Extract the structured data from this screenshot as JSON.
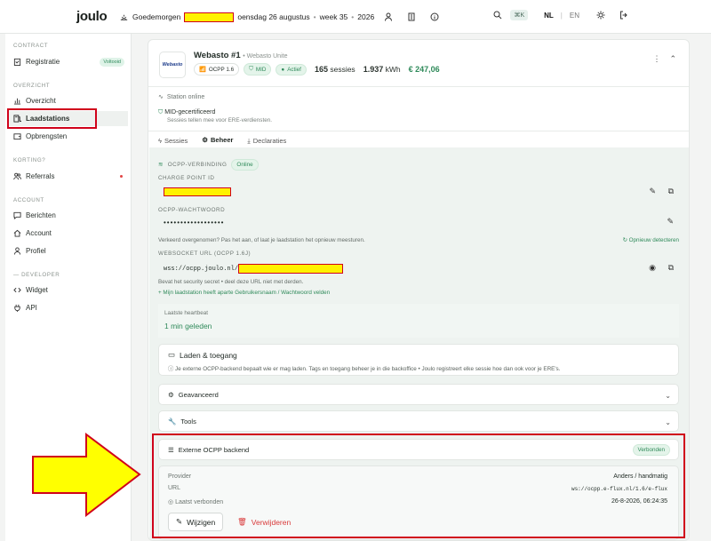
{
  "topbar": {
    "logo": "joulo",
    "greeting": "Goedemorgen",
    "date": "oensdag 26 augustus",
    "week": "week 35",
    "year": "2026",
    "shortcut": "⌘K",
    "lang_nl": "NL",
    "lang_en": "EN"
  },
  "sidebar": {
    "sec_contract": "CONTRACT",
    "registratie": "Registratie",
    "registratie_badge": "Voltooid",
    "sec_overzicht": "OVERZICHT",
    "overzicht": "Overzicht",
    "laadstations": "Laadstations",
    "opbrengsten": "Opbrengsten",
    "sec_korting": "KORTING?",
    "referrals": "Referrals",
    "sec_account": "ACCOUNT",
    "berichten": "Berichten",
    "account": "Account",
    "profiel": "Profiel",
    "sec_developer": "DEVELOPER",
    "widget": "Widget",
    "api": "API"
  },
  "station": {
    "logo_text": "Webasto",
    "title": "Webasto #1",
    "subtitle": "Webasto Unite",
    "ocpp_pill": "OCPP 1.6",
    "mid_pill": "MID",
    "actief_pill": "Actief",
    "sessions_count": "165",
    "sessions_label": "sessies",
    "kwh_value": "1.937",
    "kwh_unit": "kWh",
    "money": "€ 247,06",
    "status": "Station online",
    "mid_title": "MID-gecertificeerd",
    "mid_sub": "Sessies tellen mee voor ERE-verdiensten."
  },
  "tabs": {
    "sessies": "Sessies",
    "beheer": "Beheer",
    "declaraties": "Declaraties"
  },
  "beheer": {
    "ocpp_label": "OCPP-VERBINDING",
    "ocpp_status": "Online",
    "cp_id_label": "CHARGE POINT ID",
    "pw_label": "OCPP-WACHTWOORD",
    "pw_value": "••••••••••••••••••",
    "pw_help": "Verkeerd overgenomen? Pas het aan, of laat je laadstation het opnieuw meesturen.",
    "redetect": "Opnieuw detecteren",
    "ws_label": "WEBSOCKET URL (OCPP 1.6J)",
    "ws_value": "wss://ocpp.joulo.nl/",
    "ws_help": "Bevat het security secret • deel deze URL niet met derden.",
    "ws_note": "+ Mijn laadstation heeft aparte Gebruikersnaam / Wachtwoord velden",
    "hb_label": "Laatste heartbeat",
    "hb_value": "1 min geleden",
    "laden_title": "Laden & toegang",
    "laden_text": "Je externe OCPP-backend bepaalt wie er mag laden. Tags en toegang beheer je in die backoffice • Joulo registreert elke sessie hoe dan ook voor je ERE's.",
    "geavanceerd": "Geavanceerd",
    "tools": "Tools"
  },
  "external": {
    "title": "Externe OCPP backend",
    "status": "Verbonden",
    "provider_label": "Provider",
    "provider_value": "Anders / handmatig",
    "url_label": "URL",
    "url_value": "ws://ocpp.e-flux.nl/1.6/e-flux",
    "last_label": "Laatst verbonden",
    "last_value": "26-8-2026, 06:24:35",
    "edit_button": "Wijzigen",
    "delete_button": "Verwijderen"
  },
  "colors": {
    "accent": "#2f8a5a",
    "highlight": "#d0021b",
    "redact": "#fff200",
    "arrow": "#ffff00"
  }
}
